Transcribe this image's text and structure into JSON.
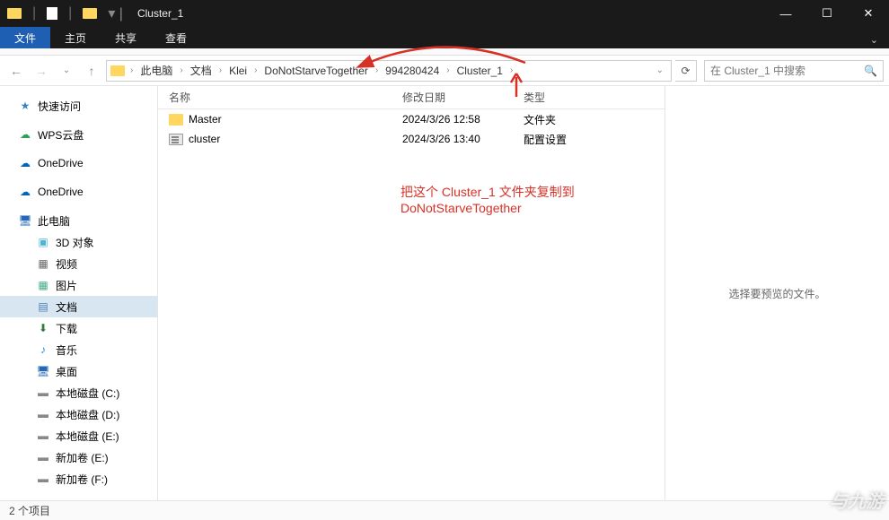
{
  "window": {
    "title": "Cluster_1"
  },
  "ribbon": {
    "file": "文件",
    "tabs": [
      "主页",
      "共享",
      "查看"
    ]
  },
  "breadcrumb": [
    "此电脑",
    "文档",
    "Klei",
    "DoNotStarveTogether",
    "994280424",
    "Cluster_1"
  ],
  "search": {
    "placeholder": "在 Cluster_1 中搜索"
  },
  "columns": {
    "name": "名称",
    "date": "修改日期",
    "type": "类型"
  },
  "files": [
    {
      "name": "Master",
      "date": "2024/3/26 12:58",
      "type": "文件夹",
      "icon": "folder"
    },
    {
      "name": "cluster",
      "date": "2024/3/26 13:40",
      "type": "配置设置",
      "icon": "ini"
    }
  ],
  "preview_text": "选择要预览的文件。",
  "status": "2 个项目",
  "sidebar": {
    "quick": "快速访问",
    "wps": "WPS云盘",
    "od1": "OneDrive",
    "od2": "OneDrive",
    "pc": "此电脑",
    "items": [
      "3D 对象",
      "视频",
      "图片",
      "文档",
      "下载",
      "音乐",
      "桌面",
      "本地磁盘 (C:)",
      "本地磁盘 (D:)",
      "本地磁盘 (E:)",
      "新加卷 (E:)",
      "新加卷 (F:)"
    ]
  },
  "annotation": "把这个 Cluster_1 文件夹复制到 DoNotStarveTogether",
  "watermark": "与九游"
}
